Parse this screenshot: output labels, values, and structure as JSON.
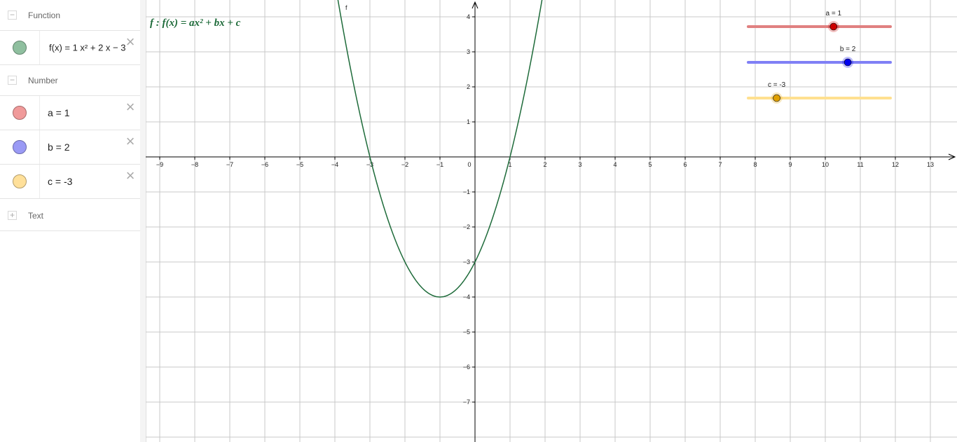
{
  "algebra": {
    "categories": {
      "function": {
        "label": "Function",
        "toggle": "−"
      },
      "number": {
        "label": "Number",
        "toggle": "−"
      },
      "text": {
        "label": "Text",
        "toggle": "+"
      }
    },
    "function_item": {
      "expression": "f(x) = 1 x² + 2 x − 3",
      "color": "#8fbf9f"
    },
    "numbers": [
      {
        "expression": "a = 1",
        "color": "#f09a9a"
      },
      {
        "expression": "b = 2",
        "color": "#9a9af5"
      },
      {
        "expression": "c = -3",
        "color": "#ffe09a"
      }
    ],
    "delete_icon": "×"
  },
  "graphics": {
    "equation_text": "f : f(x) = ax² + bx + c",
    "curve_label": "f",
    "curve_color": "#1e6b3a",
    "sliders": [
      {
        "label": "a = 1",
        "color": "#cc0000",
        "track_color": "#e08080",
        "value": 1,
        "min": -5,
        "max": 5
      },
      {
        "label": "b = 2",
        "color": "#0000ee",
        "track_color": "#8080f5",
        "value": 2,
        "min": -5,
        "max": 5
      },
      {
        "label": "c = -3",
        "color": "#e0a000",
        "track_color": "#ffe090",
        "value": -3,
        "min": -5,
        "max": 5
      }
    ]
  },
  "chart_data": {
    "type": "line",
    "series": [
      {
        "name": "f",
        "expression": "x^2 + 2x - 3",
        "x": [
          -3.9,
          -3.5,
          -3,
          -2.5,
          -2,
          -1.5,
          -1,
          -0.5,
          0,
          0.5,
          1,
          1.5,
          1.9
        ],
        "y": [
          4.41,
          2.25,
          0,
          -1.75,
          -3,
          -3.75,
          -4,
          -3.75,
          -3,
          -1.75,
          0,
          2.25,
          4.41
        ]
      }
    ],
    "xlim": [
      -9.5,
      13.7
    ],
    "ylim": [
      -8,
      4.5
    ],
    "x_ticks": [
      -9,
      -8,
      -7,
      -6,
      -5,
      -4,
      -3,
      -2,
      -1,
      0,
      1,
      2,
      3,
      4,
      5,
      6,
      7,
      8,
      9,
      10,
      11,
      12,
      13
    ],
    "y_ticks": [
      -7,
      -6,
      -5,
      -4,
      -3,
      -2,
      -1,
      1,
      2,
      3,
      4
    ],
    "grid": true
  }
}
